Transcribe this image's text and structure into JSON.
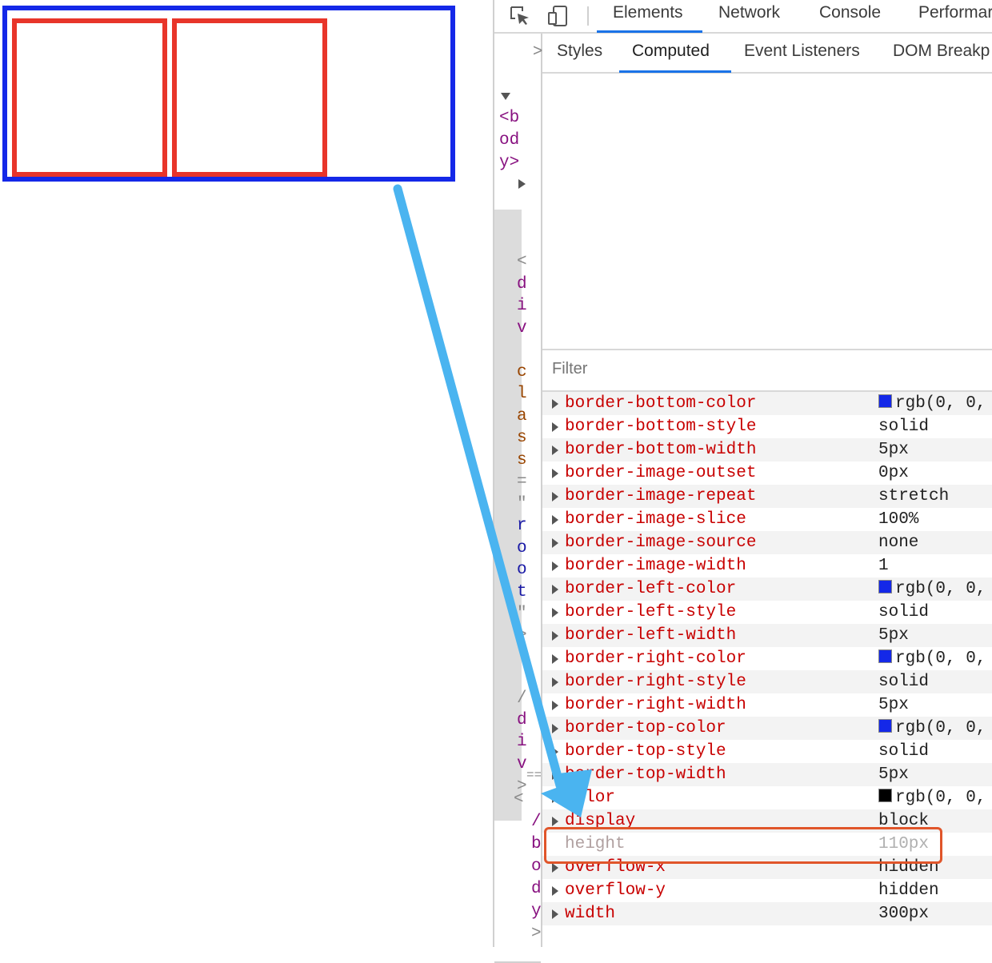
{
  "devtools": {
    "tabs": [
      "Elements",
      "Network",
      "Console",
      "Performar"
    ],
    "subtabs": [
      "Styles",
      "Computed",
      "Event Listeners",
      "DOM Breakp"
    ],
    "filter_placeholder": "Filter"
  },
  "dom_tree": {
    "body_open": [
      "<b",
      "od",
      "y>"
    ],
    "div_chars": [
      "<",
      "d",
      "i",
      "v",
      "c",
      "l",
      "a",
      "s",
      "s",
      "=",
      "\"",
      "r",
      "o",
      "o",
      "t",
      "\"",
      ">"
    ],
    "div_close": [
      "/",
      "d",
      "i",
      "v",
      ">"
    ],
    "eq": "==",
    "body_close": [
      "<",
      "/",
      "b",
      "o",
      "d",
      "y",
      ">"
    ]
  },
  "computed": [
    {
      "name": "border-bottom-color",
      "value": "rgb(0, 0,",
      "swatch": "#1428e8"
    },
    {
      "name": "border-bottom-style",
      "value": "solid"
    },
    {
      "name": "border-bottom-width",
      "value": "5px"
    },
    {
      "name": "border-image-outset",
      "value": "0px"
    },
    {
      "name": "border-image-repeat",
      "value": "stretch"
    },
    {
      "name": "border-image-slice",
      "value": "100%"
    },
    {
      "name": "border-image-source",
      "value": "none"
    },
    {
      "name": "border-image-width",
      "value": "1"
    },
    {
      "name": "border-left-color",
      "value": "rgb(0, 0,",
      "swatch": "#1428e8"
    },
    {
      "name": "border-left-style",
      "value": "solid"
    },
    {
      "name": "border-left-width",
      "value": "5px"
    },
    {
      "name": "border-right-color",
      "value": "rgb(0, 0,",
      "swatch": "#1428e8"
    },
    {
      "name": "border-right-style",
      "value": "solid"
    },
    {
      "name": "border-right-width",
      "value": "5px"
    },
    {
      "name": "border-top-color",
      "value": "rgb(0, 0,",
      "swatch": "#1428e8"
    },
    {
      "name": "border-top-style",
      "value": "solid"
    },
    {
      "name": "border-top-width",
      "value": "5px"
    },
    {
      "name": "color",
      "value": "rgb(0, 0,",
      "swatch": "#000000"
    },
    {
      "name": "display",
      "value": "block"
    },
    {
      "name": "height",
      "value": "110px",
      "inherited": true
    },
    {
      "name": "overflow-x",
      "value": "hidden"
    },
    {
      "name": "overflow-y",
      "value": "hidden"
    },
    {
      "name": "width",
      "value": "300px"
    }
  ],
  "colors": {
    "root_border": "#1428e8",
    "child_border": "#e8352a",
    "arrow": "#4ab4f0",
    "highlight": "#e0552a"
  }
}
